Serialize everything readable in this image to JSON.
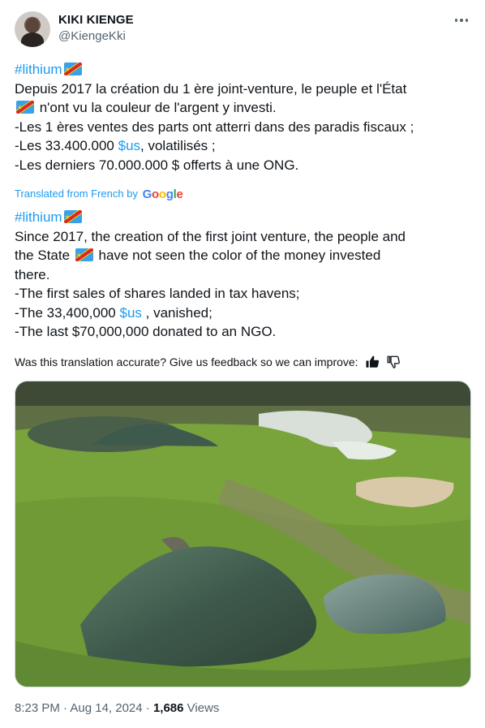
{
  "author": {
    "name": "KIKI KIENGE",
    "handle": "@KiengeKki"
  },
  "original": {
    "hashtag": "#lithium",
    "line1": "Depuis 2017 la création du 1 ère joint-venture, le peuple et l'État",
    "line2": " n'ont vu la couleur de l'argent y investi.",
    "line3": "-Les 1 ères ventes des parts ont atterri dans des paradis fiscaux ;",
    "line4_pre": "-Les 33.400.000 ",
    "line4_link": "$us",
    "line4_post": ", volatilisés ;",
    "line5": "-Les derniers 70.000.000 $ offerts à une ONG."
  },
  "translation_label": "Translated from French by",
  "google_letters": [
    "G",
    "o",
    "o",
    "g",
    "l",
    "e"
  ],
  "translated": {
    "hashtag": "#lithium",
    "line1": "Since 2017, the creation of the first joint venture, the people and",
    "line2_pre": "the State ",
    "line2_post": " have not seen the color of the money invested",
    "line3": "there.",
    "line4": "-The first sales of shares landed in tax havens;",
    "line5_pre": "-The 33,400,000 ",
    "line5_link": "$us",
    "line5_post": " , vanished;",
    "line6": "-The last $70,000,000 donated to an NGO."
  },
  "feedback_prompt": "Was this translation accurate? Give us feedback so we can improve:",
  "footer": {
    "time": "8:23 PM · Aug 14, 2024 · ",
    "views_count": "1,686",
    "views_label": " Views"
  },
  "colors": {
    "link": "#1d9bf0",
    "secondary": "#536471",
    "text": "#0f1419"
  },
  "icons": [
    "more-icon",
    "flag-icon",
    "thumbs-up-icon",
    "thumbs-down-icon"
  ]
}
